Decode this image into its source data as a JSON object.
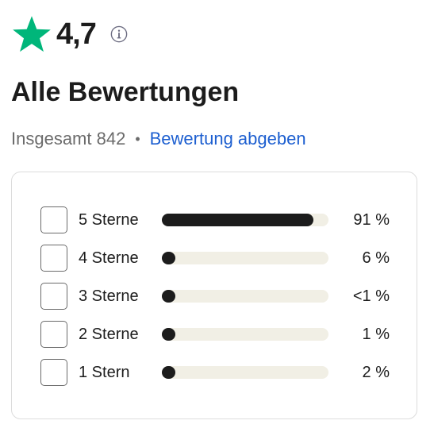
{
  "header": {
    "rating": "4,7",
    "icon": "star-icon",
    "info_icon": "info-icon",
    "star_color": "#00b67a"
  },
  "reviews": {
    "title": "Alle Bewertungen",
    "total_label": "Insgesamt 842",
    "separator": "•",
    "write_review_link": "Bewertung abgeben",
    "link_color": "#1d5fd0"
  },
  "distribution": [
    {
      "label": "5 Sterne",
      "percent_text": "91 %",
      "fraction": 0.91
    },
    {
      "label": "4 Sterne",
      "percent_text": "6 %",
      "fraction": 0.06
    },
    {
      "label": "3 Sterne",
      "percent_text": "<1 %",
      "fraction": 0.005
    },
    {
      "label": "2 Sterne",
      "percent_text": "1 %",
      "fraction": 0.01
    },
    {
      "label": "1 Stern",
      "percent_text": "2 %",
      "fraction": 0.02
    }
  ]
}
